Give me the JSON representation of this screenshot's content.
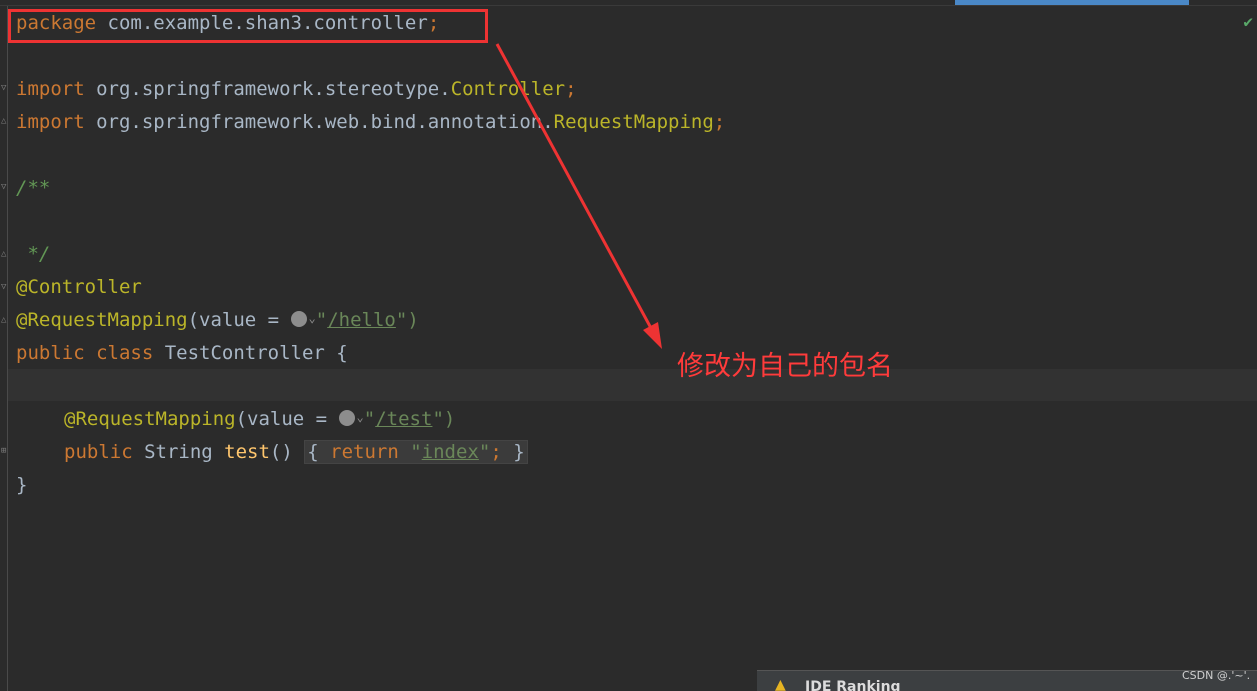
{
  "editor": {
    "lines": {
      "package_kw": "package",
      "package_name": " com.example.shan3.controller",
      "semi": ";",
      "import_kw": "import",
      "import1_path": " org.springframework.stereotype.",
      "import1_cls": "Controller",
      "import2_path": " org.springframework.web.bind.annotation.",
      "import2_cls": "RequestMapping",
      "doc_open": "/**",
      "doc_close": " */",
      "ann_controller": "@Controller",
      "ann_requestmapping": "@RequestMapping",
      "value_eq": "(value = ",
      "hello_open": "\"",
      "hello_path": "/hello",
      "hello_close": "\")",
      "public_kw": "public",
      "class_kw": " class",
      "class_name": " TestController {",
      "method_ann": "@RequestMapping",
      "test_open": "\"",
      "test_path": "/test",
      "test_close": "\")",
      "method_public": "public",
      "method_type": " String ",
      "method_name": "test",
      "method_parens": "() ",
      "brace_open": "{",
      "return_kw": " return ",
      "index_open": "\"",
      "index_val": "index",
      "index_close": "\"",
      "brace_close": " }",
      "closing_brace": "}"
    }
  },
  "annotation": {
    "text": "修改为自己的包名",
    "color": "#ff3b3b"
  },
  "popup": {
    "title": "IDE Ranking"
  },
  "watermark": "CSDN @.'~'.",
  "colors": {
    "keyword": "#cc7832",
    "annotation": "#bbb529",
    "string": "#6a8759",
    "comment": "#629755",
    "text": "#a9b7c6",
    "highlight": "#ee3333"
  }
}
